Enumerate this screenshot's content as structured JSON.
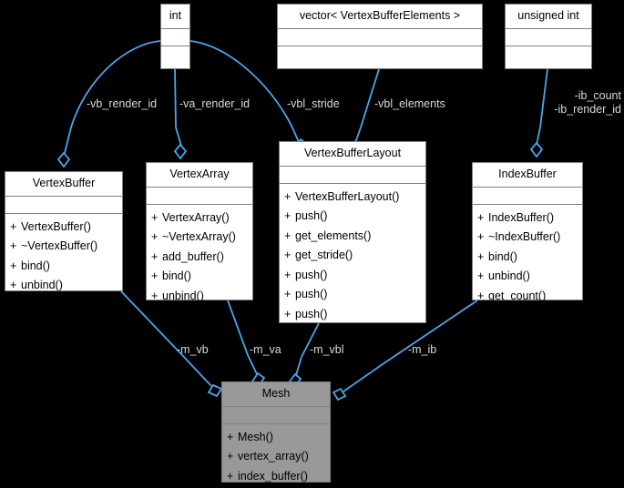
{
  "diagram": {
    "title": "Mesh collaboration diagram",
    "colors": {
      "background": "#000000",
      "box_fill": "#ffffff",
      "highlight_fill": "#999999",
      "box_border": "#808080",
      "edge": "#4ba6ed",
      "label_text": "#d9d9d9",
      "member_text": "#000000"
    }
  },
  "nodes": {
    "int": {
      "name": "int",
      "attributes": [],
      "methods": []
    },
    "vector_elements": {
      "name": "vector< VertexBufferElements >",
      "attributes": [],
      "methods": []
    },
    "unsigned_int": {
      "name": "unsigned int",
      "attributes": [],
      "methods": []
    },
    "vertex_buffer": {
      "name": "VertexBuffer",
      "attributes": [],
      "methods": [
        {
          "vis": "+",
          "label": "VertexBuffer()"
        },
        {
          "vis": "+",
          "label": "~VertexBuffer()"
        },
        {
          "vis": "+",
          "label": "bind()"
        },
        {
          "vis": "+",
          "label": "unbind()"
        }
      ]
    },
    "vertex_array": {
      "name": "VertexArray",
      "attributes": [],
      "methods": [
        {
          "vis": "+",
          "label": "VertexArray()"
        },
        {
          "vis": "+",
          "label": "~VertexArray()"
        },
        {
          "vis": "+",
          "label": "add_buffer()"
        },
        {
          "vis": "+",
          "label": "bind()"
        },
        {
          "vis": "+",
          "label": "unbind()"
        }
      ]
    },
    "vertex_buffer_layout": {
      "name": "VertexBufferLayout",
      "attributes": [],
      "methods": [
        {
          "vis": "+",
          "label": "VertexBufferLayout()"
        },
        {
          "vis": "+",
          "label": "push()"
        },
        {
          "vis": "+",
          "label": "get_elements()"
        },
        {
          "vis": "+",
          "label": "get_stride()"
        },
        {
          "vis": "+",
          "label": "push()"
        },
        {
          "vis": "+",
          "label": "push()"
        },
        {
          "vis": "+",
          "label": "push()"
        }
      ]
    },
    "index_buffer": {
      "name": "IndexBuffer",
      "attributes": [],
      "methods": [
        {
          "vis": "+",
          "label": "IndexBuffer()"
        },
        {
          "vis": "+",
          "label": "~IndexBuffer()"
        },
        {
          "vis": "+",
          "label": "bind()"
        },
        {
          "vis": "+",
          "label": "unbind()"
        },
        {
          "vis": "+",
          "label": "get_count()"
        }
      ]
    },
    "mesh": {
      "name": "Mesh",
      "attributes": [],
      "methods": [
        {
          "vis": "+",
          "label": "Mesh()"
        },
        {
          "vis": "+",
          "label": "vertex_array()"
        },
        {
          "vis": "+",
          "label": "index_buffer()"
        }
      ]
    }
  },
  "edge_labels": {
    "vb_render_id": "-vb_render_id",
    "va_render_id": "-va_render_id",
    "vbl_stride": "-vbl_stride",
    "vbl_elements": "-vbl_elements",
    "ib_count": "-ib_count",
    "ib_render_id": "-ib_render_id",
    "m_vb": "-m_vb",
    "m_va": "-m_va",
    "m_vbl": "-m_vbl",
    "m_ib": "-m_ib"
  }
}
